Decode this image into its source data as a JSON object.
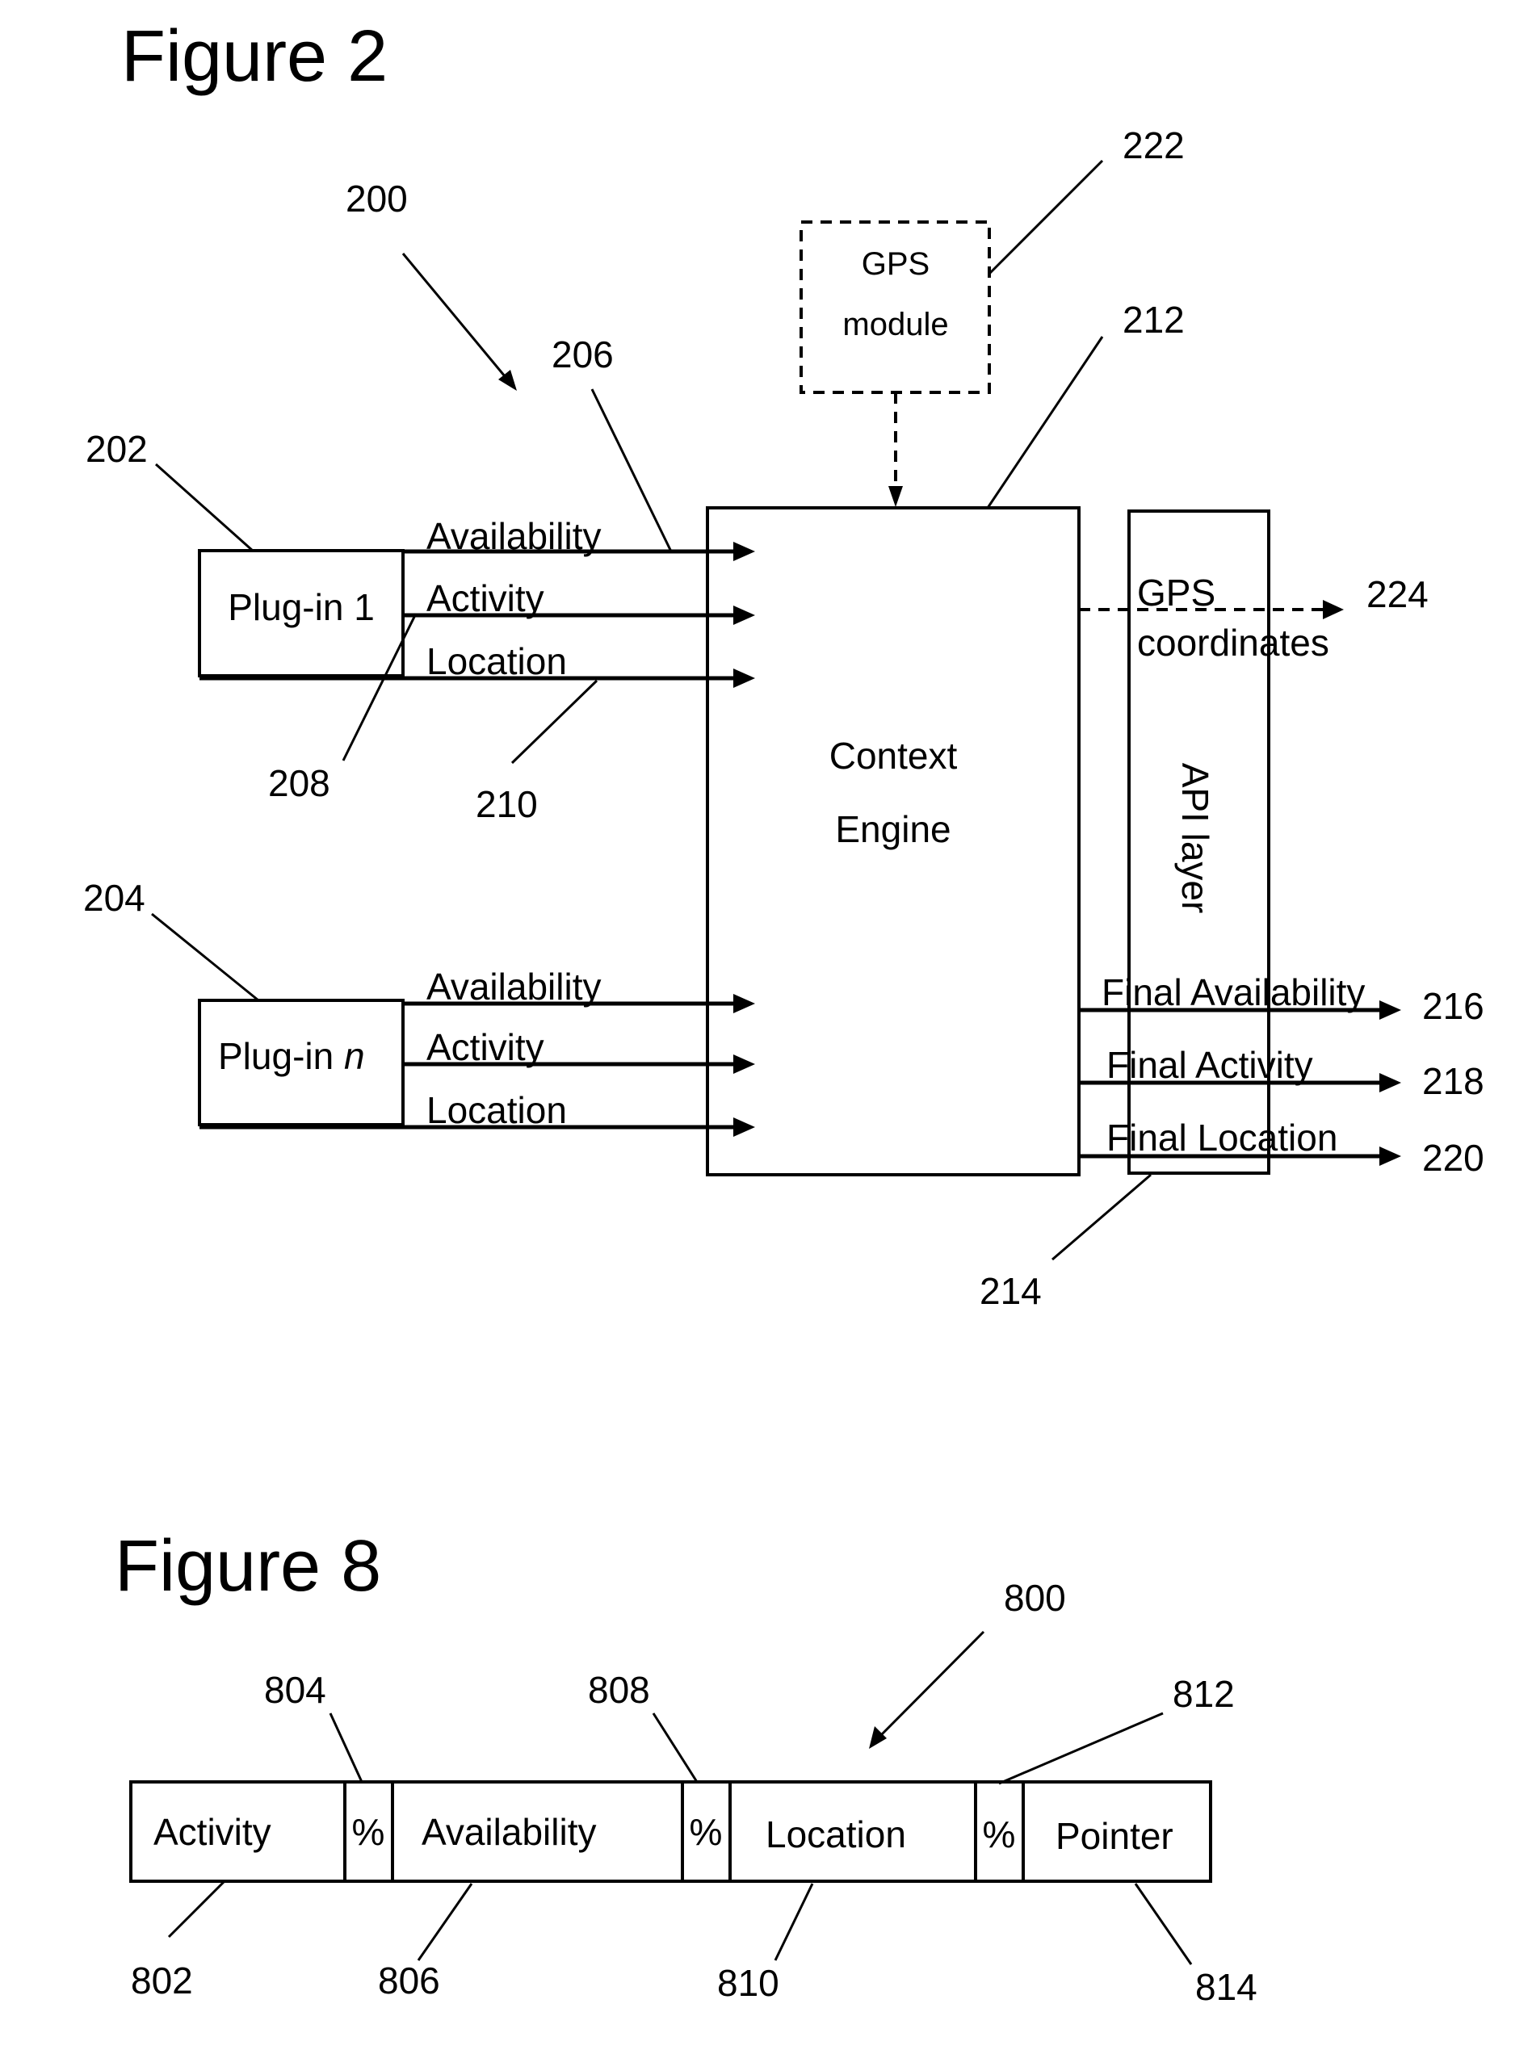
{
  "figure2": {
    "title": "Figure 2",
    "refs": {
      "system": "200",
      "plugin1": "202",
      "pluginN": "204",
      "availability": "206",
      "activity": "208",
      "location": "210",
      "context_engine": "212",
      "api_layer": "214",
      "final_availability": "216",
      "final_activity": "218",
      "final_location": "220",
      "gps_module": "222",
      "gps_coordinates": "224"
    },
    "plugin1": {
      "label": "Plug-in 1",
      "outputs": [
        "Availability",
        "Activity",
        "Location"
      ]
    },
    "pluginN": {
      "label_prefix": "Plug-in ",
      "label_italic": "n",
      "outputs": [
        "Availability",
        "Activity",
        "Location"
      ]
    },
    "gps_module": {
      "line1": "GPS",
      "line2": "module"
    },
    "context_engine": {
      "line1": "Context",
      "line2": "Engine"
    },
    "api_layer": {
      "label": "API layer"
    },
    "gps_coordinates": {
      "line1": "GPS",
      "line2": "coordinates"
    },
    "final_outputs": [
      "Final Availability",
      "Final Activity",
      "Final Location"
    ]
  },
  "figure8": {
    "title": "Figure 8",
    "refs": {
      "record": "800",
      "activity": "802",
      "sep1": "804",
      "availability": "806",
      "sep2": "808",
      "location": "810",
      "sep3": "812",
      "pointer": "814"
    },
    "fields": [
      "Activity",
      "%",
      "Availability",
      "%",
      "Location",
      "%",
      "Pointer"
    ]
  }
}
